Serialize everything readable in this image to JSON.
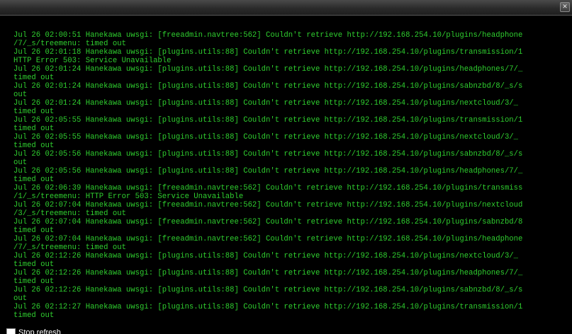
{
  "titlebar": {
    "close_icon": "close-icon",
    "close_glyph": "✕"
  },
  "log": {
    "color": "#2fcf2f",
    "lines": [
      "Jul 26 02:00:51 Hanekawa uwsgi: [freeadmin.navtree:562] Couldn't retrieve http://192.168.254.10/plugins/headphone",
      "/7/_s/treemenu: timed out",
      "Jul 26 02:01:18 Hanekawa uwsgi: [plugins.utils:88] Couldn't retrieve http://192.168.254.10/plugins/transmission/1",
      "HTTP Error 503: Service Unavailable",
      "Jul 26 02:01:24 Hanekawa uwsgi: [plugins.utils:88] Couldn't retrieve http://192.168.254.10/plugins/headphones/7/_",
      "timed out",
      "Jul 26 02:01:24 Hanekawa uwsgi: [plugins.utils:88] Couldn't retrieve http://192.168.254.10/plugins/sabnzbd/8/_s/s",
      "out",
      "Jul 26 02:01:24 Hanekawa uwsgi: [plugins.utils:88] Couldn't retrieve http://192.168.254.10/plugins/nextcloud/3/_",
      "timed out",
      "Jul 26 02:05:55 Hanekawa uwsgi: [plugins.utils:88] Couldn't retrieve http://192.168.254.10/plugins/transmission/1",
      "timed out",
      "Jul 26 02:05:55 Hanekawa uwsgi: [plugins.utils:88] Couldn't retrieve http://192.168.254.10/plugins/nextcloud/3/_",
      "timed out",
      "Jul 26 02:05:56 Hanekawa uwsgi: [plugins.utils:88] Couldn't retrieve http://192.168.254.10/plugins/sabnzbd/8/_s/s",
      "out",
      "Jul 26 02:05:56 Hanekawa uwsgi: [plugins.utils:88] Couldn't retrieve http://192.168.254.10/plugins/headphones/7/_",
      "timed out",
      "Jul 26 02:06:39 Hanekawa uwsgi: [freeadmin.navtree:562] Couldn't retrieve http://192.168.254.10/plugins/transmiss",
      "/1/_s/treemenu: HTTP Error 503: Service Unavailable",
      "Jul 26 02:07:04 Hanekawa uwsgi: [freeadmin.navtree:562] Couldn't retrieve http://192.168.254.10/plugins/nextcloud",
      "/3/_s/treemenu: timed out",
      "Jul 26 02:07:04 Hanekawa uwsgi: [freeadmin.navtree:562] Couldn't retrieve http://192.168.254.10/plugins/sabnzbd/8",
      "timed out",
      "Jul 26 02:07:04 Hanekawa uwsgi: [freeadmin.navtree:562] Couldn't retrieve http://192.168.254.10/plugins/headphone",
      "/7/_s/treemenu: timed out",
      "Jul 26 02:12:26 Hanekawa uwsgi: [plugins.utils:88] Couldn't retrieve http://192.168.254.10/plugins/nextcloud/3/_",
      "timed out",
      "Jul 26 02:12:26 Hanekawa uwsgi: [plugins.utils:88] Couldn't retrieve http://192.168.254.10/plugins/headphones/7/_",
      "timed out",
      "Jul 26 02:12:26 Hanekawa uwsgi: [plugins.utils:88] Couldn't retrieve http://192.168.254.10/plugins/sabnzbd/8/_s/s",
      "out",
      "Jul 26 02:12:27 Hanekawa uwsgi: [plugins.utils:88] Couldn't retrieve http://192.168.254.10/plugins/transmission/1",
      "timed out"
    ]
  },
  "footer": {
    "stop_refresh_label": "Stop refresh",
    "stop_refresh_checked": false
  }
}
